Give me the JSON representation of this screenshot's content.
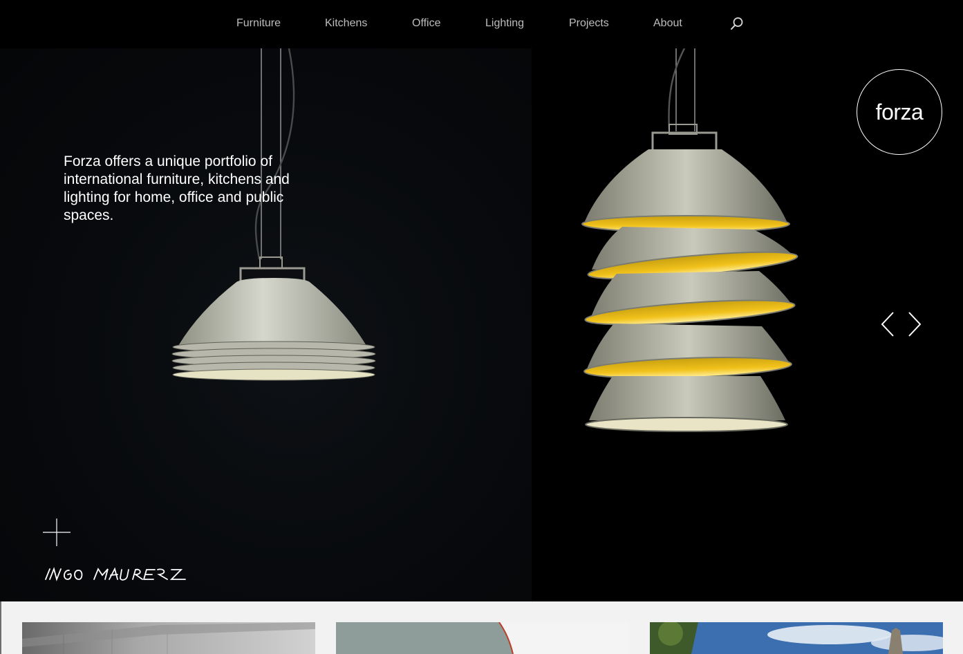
{
  "nav": {
    "items": [
      "Furniture",
      "Kitchens",
      "Office",
      "Lighting",
      "Projects",
      "About"
    ],
    "search_icon": "search-icon"
  },
  "hero": {
    "tagline": "Forza offers a unique portfolio of international furniture, kitchens and lighting for home, office and public spaces.",
    "brand": "forza",
    "designer_signature": "INGO MAURER",
    "prev_icon": "chevron-left-icon",
    "next_icon": "chevron-right-icon",
    "expand_icon": "plus-icon"
  },
  "colors": {
    "nav_bg": "#000000",
    "nav_text": "#bdbdbd",
    "hero_bg": "#06080b",
    "lamp_glow": "#f2c21b",
    "page_bg": "#f2f2f2"
  }
}
